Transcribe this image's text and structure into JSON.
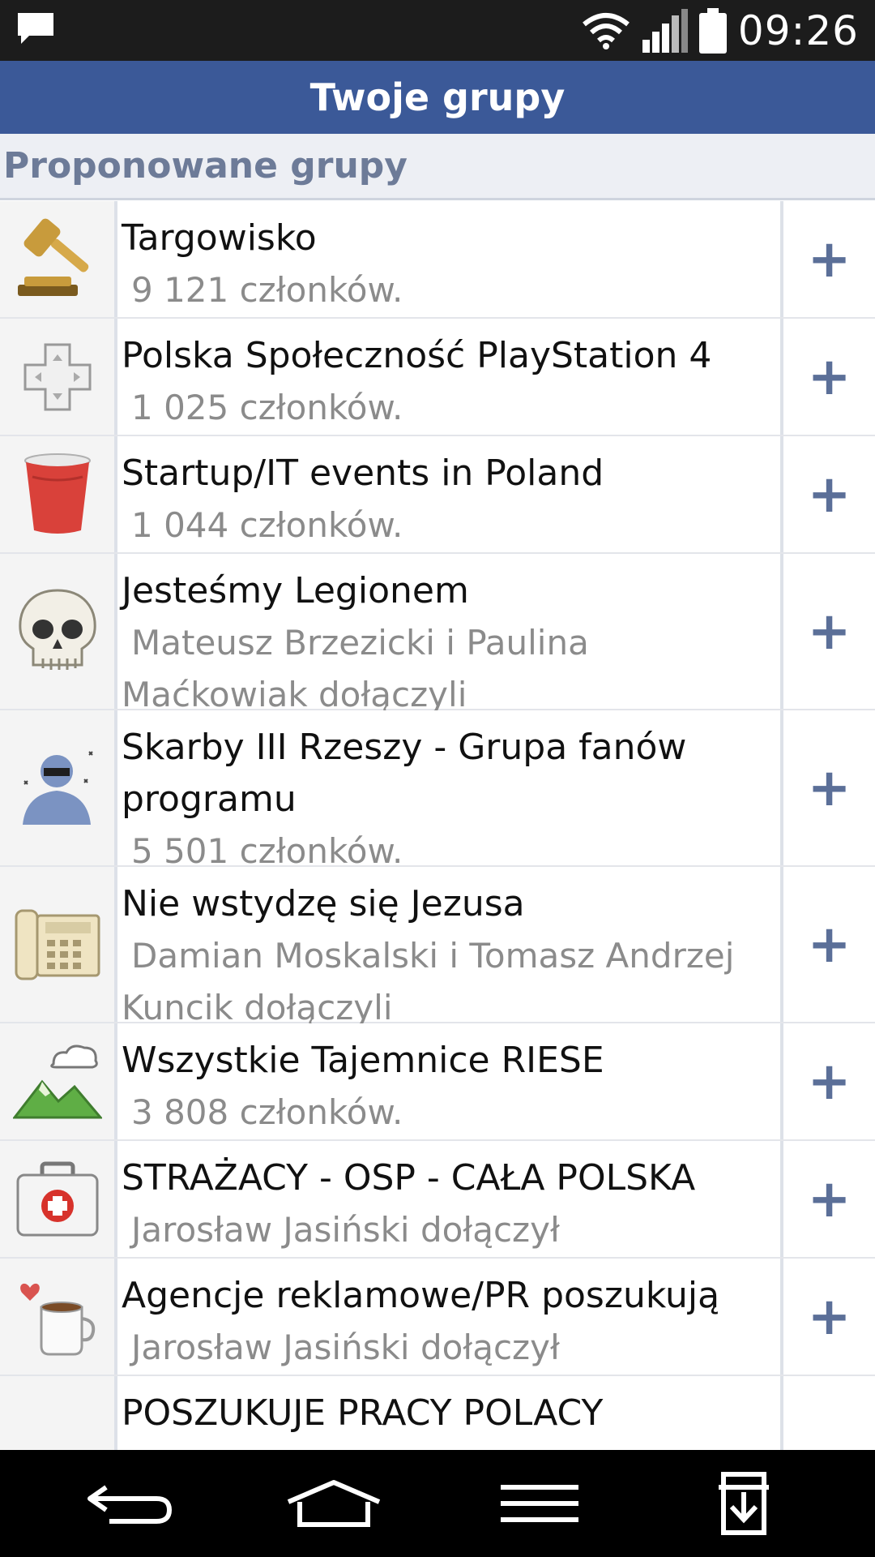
{
  "status_bar": {
    "time": "09:26",
    "icons": [
      "notification-icon",
      "wifi-icon",
      "signal-icon",
      "battery-icon"
    ]
  },
  "header": {
    "title": "Twoje grupy"
  },
  "section": {
    "title": "Proponowane grupy"
  },
  "groups": [
    {
      "name": "Targowisko",
      "subtitle": "9 121 członków.",
      "icon": "gavel-icon",
      "action": "+"
    },
    {
      "name": "Polska Społeczność PlayStation 4",
      "subtitle": "1 025 członków.",
      "icon": "gamepad-icon",
      "action": "+"
    },
    {
      "name": "Startup/IT events in Poland",
      "subtitle": "1 044 członków.",
      "icon": "cup-icon",
      "action": "+"
    },
    {
      "name": "Jesteśmy Legionem",
      "subtitle": "Mateusz Brzezicki i Paulina Maćkowiak dołączyli",
      "icon": "skull-icon",
      "action": "+"
    },
    {
      "name": "Skarby III Rzeszy - Grupa fanów programu",
      "subtitle": "5 501 członków.",
      "icon": "person-sunglasses-icon",
      "action": "+"
    },
    {
      "name": "Nie wstydzę się Jezusa",
      "subtitle": "Damian Moskalski i Tomasz Andrzej Kuncik dołączyli",
      "icon": "telephone-icon",
      "action": "+"
    },
    {
      "name": "Wszystkie Tajemnice RIESE",
      "subtitle": "3 808 członków.",
      "icon": "landscape-icon",
      "action": "+"
    },
    {
      "name": "STRAŻACY - OSP - CAŁA POLSKA",
      "subtitle": "Jarosław Jasiński dołączył",
      "icon": "first-aid-kit-icon",
      "action": "+"
    },
    {
      "name": "Agencje reklamowe/PR poszukują",
      "subtitle": "Jarosław Jasiński dołączył",
      "icon": "coffee-mug-icon",
      "action": "+"
    },
    {
      "name": "POSZUKUJE PRACY POLACY POŁĄCZMY SIĘ RAZEM Z CAŁYM",
      "subtitle": "",
      "icon": "money-icon",
      "action": ""
    }
  ],
  "nav_bar": {
    "buttons": [
      "back-icon",
      "home-icon",
      "menu-icon",
      "download-icon"
    ]
  },
  "colors": {
    "header_bg": "#3b5998",
    "section_bg": "#edeff4",
    "section_text": "#6d7b98",
    "plus": "#5b6f98"
  }
}
